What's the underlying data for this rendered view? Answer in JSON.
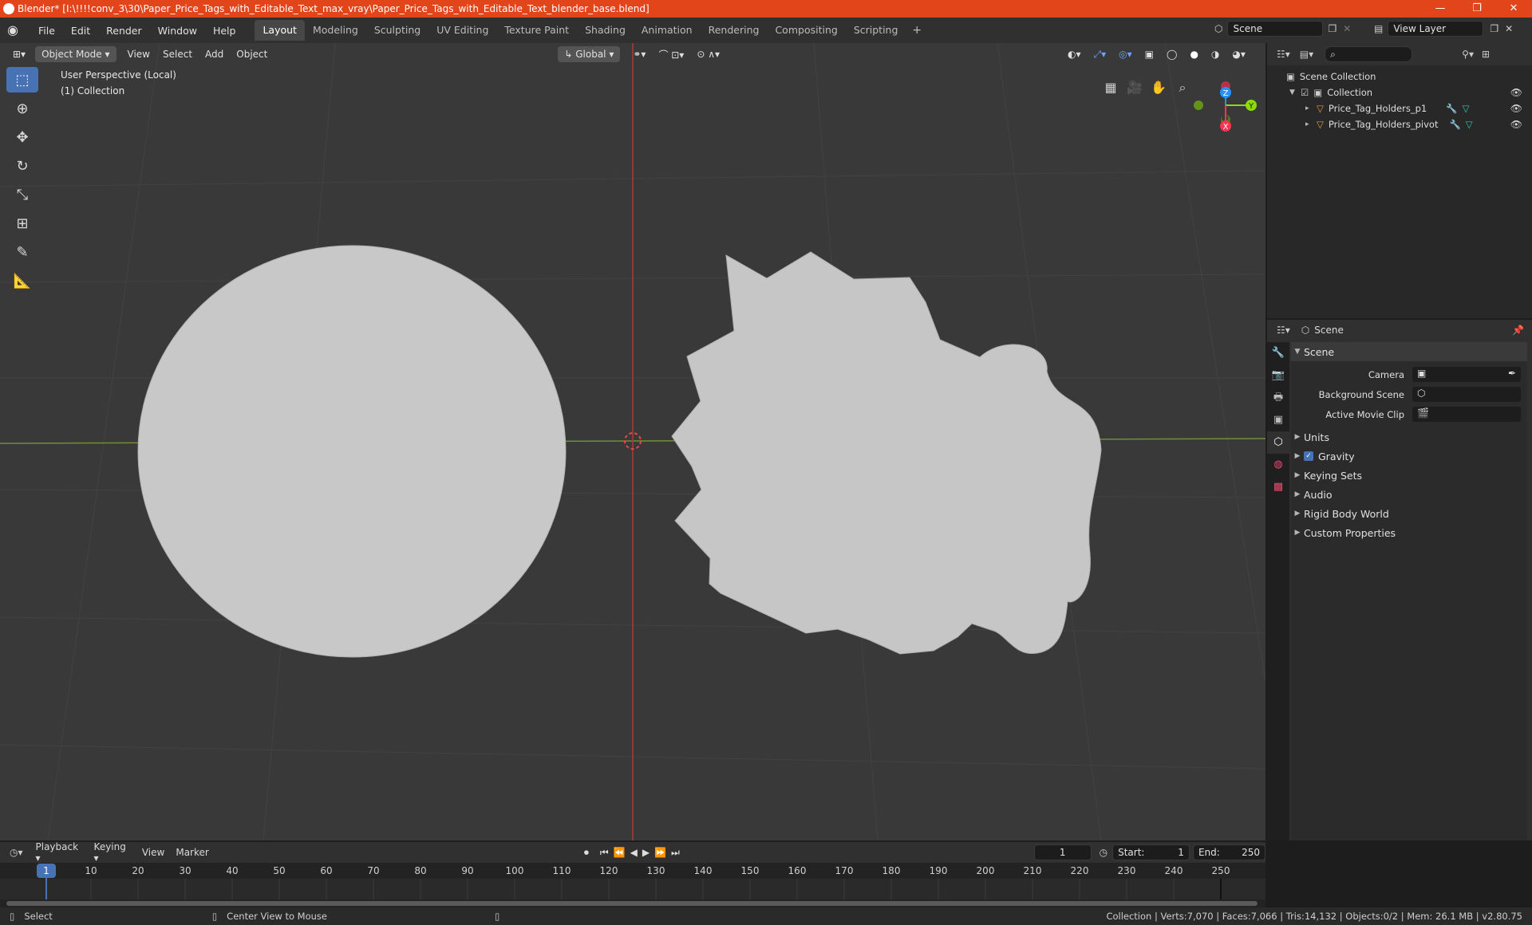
{
  "window": {
    "title": "Blender* [I:\\!!!!conv_3\\30\\Paper_Price_Tags_with_Editable_Text_max_vray\\Paper_Price_Tags_with_Editable_Text_blender_base.blend]",
    "minimize": "—",
    "maximize": "❐",
    "close": "✕"
  },
  "menu": [
    "File",
    "Edit",
    "Render",
    "Window",
    "Help"
  ],
  "workspaces": [
    "Layout",
    "Modeling",
    "Sculpting",
    "UV Editing",
    "Texture Paint",
    "Shading",
    "Animation",
    "Rendering",
    "Compositing",
    "Scripting"
  ],
  "active_workspace": "Layout",
  "scene_name": "Scene",
  "view_layer": "View Layer",
  "viewport": {
    "mode": "Object Mode",
    "menus": [
      "View",
      "Select",
      "Add",
      "Object"
    ],
    "orientation": "Global",
    "info_line1": "User Perspective (Local)",
    "info_line2": "(1) Collection",
    "axis_x": "X",
    "axis_y": "Y",
    "axis_z": "Z"
  },
  "outliner": {
    "root": "Scene Collection",
    "collection": "Collection",
    "objects": [
      "Price_Tag_Holders_p1",
      "Price_Tag_Holders_pivot"
    ]
  },
  "properties": {
    "header": "Scene",
    "panel": "Scene",
    "rows": [
      {
        "label": "Camera"
      },
      {
        "label": "Background Scene"
      },
      {
        "label": "Active Movie Clip"
      }
    ],
    "subpanels": [
      "Units",
      "Gravity",
      "Keying Sets",
      "Audio",
      "Rigid Body World",
      "Custom Properties"
    ]
  },
  "timeline": {
    "menus": [
      "Playback",
      "Keying",
      "View",
      "Marker"
    ],
    "current_frame": "1",
    "start_label": "Start:",
    "start": "1",
    "end_label": "End:",
    "end": "250",
    "ticks": [
      "1",
      "10",
      "20",
      "30",
      "40",
      "50",
      "60",
      "70",
      "80",
      "90",
      "100",
      "110",
      "120",
      "130",
      "140",
      "150",
      "160",
      "170",
      "180",
      "190",
      "200",
      "210",
      "220",
      "230",
      "240",
      "250"
    ]
  },
  "status": {
    "left_action": "Select",
    "mid_action": "Center View to Mouse",
    "stats": "Collection | Verts:7,070 | Faces:7,066 | Tris:14,132 | Objects:0/2 | Mem: 26.1 MB | v2.80.75"
  },
  "colors": {
    "title_bar": "#e2451a",
    "accent": "#4772b3",
    "x_axis": "#ff3352",
    "y_axis": "#8bdc00",
    "z_axis": "#2890ff",
    "object": "#c8c8c8"
  }
}
